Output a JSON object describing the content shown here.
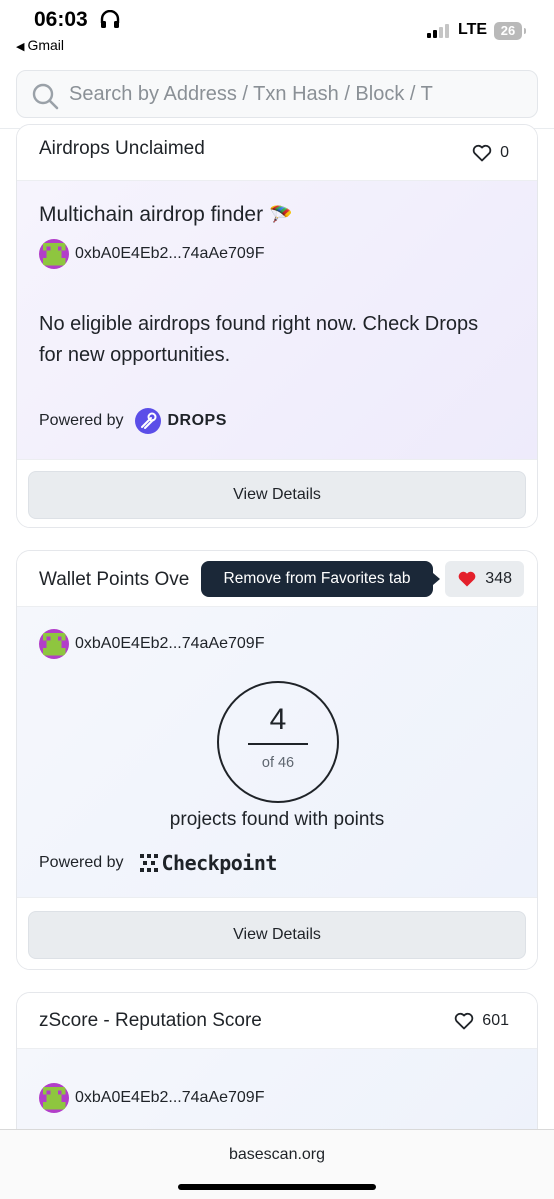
{
  "status_bar": {
    "time": "06:03",
    "back_app": "Gmail",
    "network": "LTE",
    "battery": "26"
  },
  "search": {
    "placeholder": "Search by Address / Txn Hash / Block / T"
  },
  "cards": [
    {
      "title": "Airdrops Unclaimed",
      "favorite_count": "0",
      "heading": "Multichain airdrop finder",
      "heading_emoji": "🪂",
      "address": "0xbA0E4Eb2...74aAe709F",
      "message": "No eligible airdrops found right now. Check Drops for new opportunities.",
      "powered_by": "Powered by",
      "provider": "DROPS",
      "button": "View Details"
    },
    {
      "title": "Wallet Points Ove",
      "favorite_count": "348",
      "tooltip": "Remove from Favorites tab",
      "address": "0xbA0E4Eb2...74aAe709F",
      "points_found": "4",
      "points_total": "of 46",
      "points_caption": "projects found with points",
      "powered_by": "Powered by",
      "provider": "Checkpoint",
      "button": "View Details"
    },
    {
      "title": "zScore - Reputation Score",
      "favorite_count": "601",
      "address": "0xbA0E4Eb2...74aAe709F"
    }
  ],
  "bottom_bar": {
    "domain": "basescan.org"
  },
  "colors": {
    "heart_active": "#e4202b",
    "tooltip_bg": "#1b2838",
    "drops_brand": "#5b4ee8"
  }
}
